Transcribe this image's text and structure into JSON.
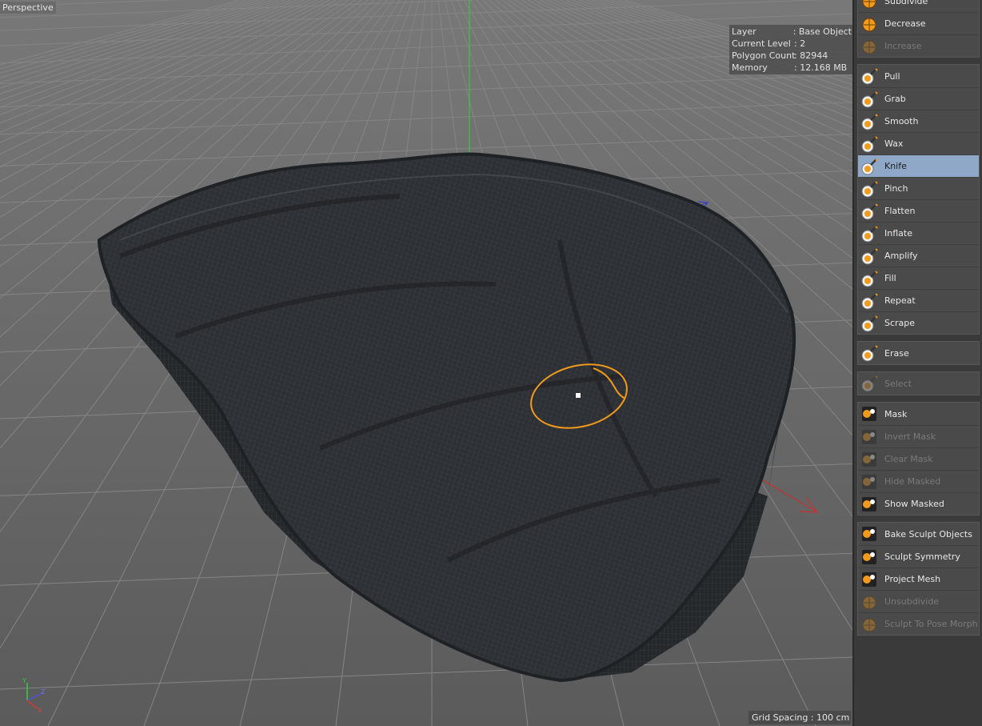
{
  "viewport": {
    "name": "Perspective",
    "hud": [
      {
        "key": "Layer",
        "value": ": Base Object"
      },
      {
        "key": "Current Level",
        "value": ": 2"
      },
      {
        "key": "Polygon Count",
        "value": ": 82944"
      },
      {
        "key": "Memory",
        "value": ": 12.168 MB"
      }
    ],
    "grid_spacing": "Grid Spacing : 100 cm",
    "axis": {
      "x": "X",
      "y": "Y",
      "z": "Z"
    }
  },
  "panel": {
    "subdivide_group": [
      {
        "label": "Subdivide",
        "state": "normal",
        "icon": "subdivide-icon"
      },
      {
        "label": "Decrease",
        "state": "normal",
        "icon": "decrease-icon"
      },
      {
        "label": "Increase",
        "state": "disabled",
        "icon": "increase-icon"
      }
    ],
    "brushes": [
      {
        "label": "Pull",
        "state": "normal",
        "icon": "pull-brush-icon"
      },
      {
        "label": "Grab",
        "state": "normal",
        "icon": "grab-brush-icon"
      },
      {
        "label": "Smooth",
        "state": "normal",
        "icon": "smooth-brush-icon"
      },
      {
        "label": "Wax",
        "state": "normal",
        "icon": "wax-brush-icon"
      },
      {
        "label": "Knife",
        "state": "active",
        "icon": "knife-brush-icon"
      },
      {
        "label": "Pinch",
        "state": "normal",
        "icon": "pinch-brush-icon"
      },
      {
        "label": "Flatten",
        "state": "normal",
        "icon": "flatten-brush-icon"
      },
      {
        "label": "Inflate",
        "state": "normal",
        "icon": "inflate-brush-icon"
      },
      {
        "label": "Amplify",
        "state": "normal",
        "icon": "amplify-brush-icon"
      },
      {
        "label": "Fill",
        "state": "normal",
        "icon": "fill-brush-icon"
      },
      {
        "label": "Repeat",
        "state": "normal",
        "icon": "repeat-brush-icon"
      },
      {
        "label": "Scrape",
        "state": "normal",
        "icon": "scrape-brush-icon"
      }
    ],
    "erase_group": [
      {
        "label": "Erase",
        "state": "normal",
        "icon": "erase-brush-icon"
      }
    ],
    "select_group": [
      {
        "label": "Select",
        "state": "disabled",
        "icon": "select-brush-icon"
      }
    ],
    "mask_group": [
      {
        "label": "Mask",
        "state": "normal",
        "icon": "mask-brush-icon"
      },
      {
        "label": "Invert Mask",
        "state": "disabled",
        "icon": "invert-mask-icon"
      },
      {
        "label": "Clear Mask",
        "state": "disabled",
        "icon": "clear-mask-icon"
      },
      {
        "label": "Hide Masked",
        "state": "disabled",
        "icon": "hide-masked-icon"
      },
      {
        "label": "Show Masked",
        "state": "normal",
        "icon": "show-masked-icon"
      }
    ],
    "tools_group": [
      {
        "label": "Bake Sculpt Objects",
        "state": "normal",
        "icon": "bake-sculpt-icon"
      },
      {
        "label": "Sculpt Symmetry",
        "state": "normal",
        "icon": "sculpt-symmetry-icon"
      },
      {
        "label": "Project Mesh",
        "state": "normal",
        "icon": "project-mesh-icon"
      },
      {
        "label": "Unsubdivide",
        "state": "disabled",
        "icon": "unsubdivide-icon"
      },
      {
        "label": "Sculpt To Pose Morph",
        "state": "disabled",
        "icon": "pose-morph-icon"
      }
    ]
  },
  "colors": {
    "accent_orange": "#f29a1c",
    "active_blue": "#8fa8c8",
    "panel_bg": "#4a4a4a",
    "viewport_bg": "#6d6d6d",
    "mesh": "#2b2e31"
  }
}
